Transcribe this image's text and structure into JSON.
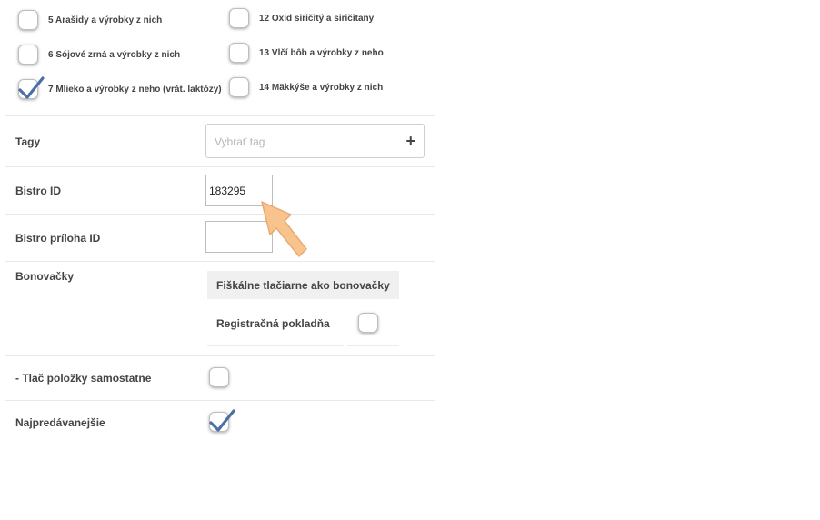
{
  "allergens": {
    "items": [
      {
        "label": "5 Arašidy a výrobky z nich",
        "checked": false
      },
      {
        "label": "6 Sójové zrná a výrobky z nich",
        "checked": false
      },
      {
        "label": "7 Mlieko a výrobky z neho (vrát. laktózy)",
        "checked": true
      },
      {
        "label": "12 Oxid siričitý a siričitany",
        "checked": false
      },
      {
        "label": "13 Vlčí bôb a výrobky z neho",
        "checked": false
      },
      {
        "label": "14 Mäkkýše a výrobky z nich",
        "checked": false
      }
    ]
  },
  "form": {
    "tags": {
      "label": "Tagy",
      "placeholder": "Vybrať tag",
      "add_icon": "+"
    },
    "bistro_id": {
      "label": "Bistro ID",
      "value": "183295"
    },
    "bistro_priloha_id": {
      "label": "Bistro príloha ID",
      "value": ""
    },
    "bonovacky": {
      "label": "Bonovačky",
      "table_header": "Fiškálne tlačiarne ako bonovačky",
      "rows": [
        {
          "label": "Registračná pokladňa",
          "checked": false
        }
      ]
    },
    "print_separately": {
      "label": "- Tlač položky samostatne",
      "checked": false
    },
    "bestsellers": {
      "label": "Najpredávanejšie",
      "checked": true
    }
  },
  "annotation": {
    "icon": "pointer-arrow-icon",
    "color": "#f9c089"
  },
  "colors": {
    "check": "#4a6fa5"
  }
}
